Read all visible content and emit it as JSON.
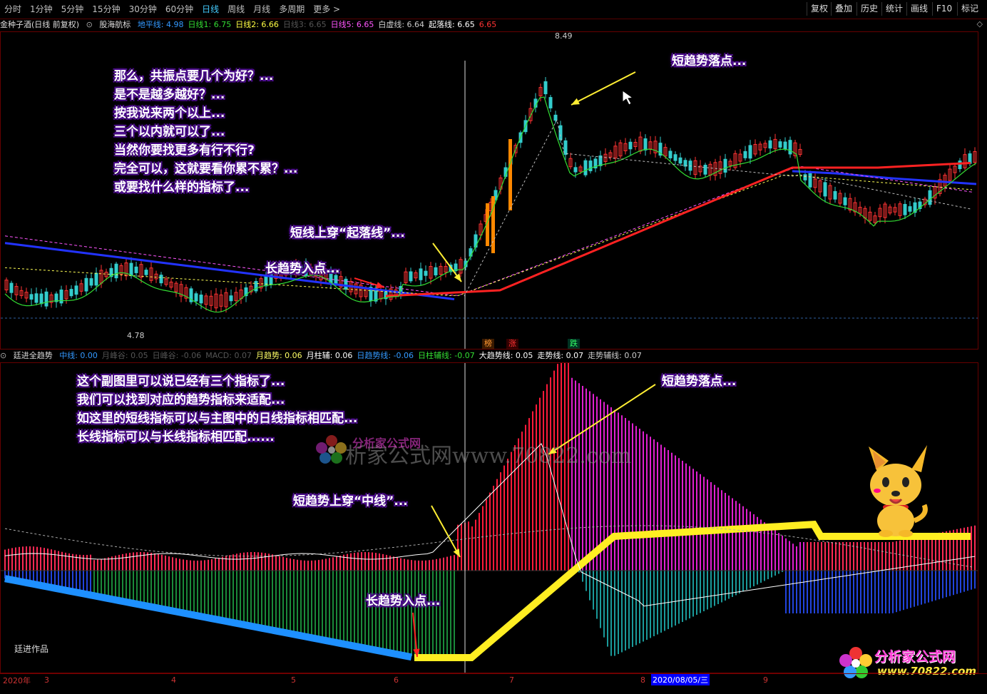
{
  "toolbar": {
    "periods": [
      "分时",
      "1分钟",
      "5分钟",
      "15分钟",
      "30分钟",
      "60分钟",
      "日线",
      "周线",
      "月线",
      "多周期",
      "更多 >"
    ],
    "active_period": "日线",
    "right_buttons": [
      "复权",
      "叠加",
      "历史",
      "统计",
      "画线",
      "F10",
      "标记"
    ]
  },
  "main_legend": {
    "stock": "金种子酒(日线 前复权)",
    "indicator": "股海航标",
    "items": [
      {
        "label": "地平线: 4.98",
        "color": "#3399ff"
      },
      {
        "label": "日线1: 6.75",
        "color": "#33dd33"
      },
      {
        "label": "日线2: 6.66",
        "color": "#ffff44"
      },
      {
        "label": "日线3: 6.65",
        "color": "#555555"
      },
      {
        "label": "日线5: 6.65",
        "color": "#ff55ff"
      },
      {
        "label": "白虚线: 6.64",
        "color": "#cccccc"
      },
      {
        "label": "起落线: 6.65",
        "color": "#ffffff"
      },
      {
        "label": "6.65",
        "color": "#ff3333"
      }
    ]
  },
  "sub_legend": {
    "indicator": "廷进全趋势",
    "items": [
      {
        "label": "中线: 0.00",
        "color": "#3399ff"
      },
      {
        "label": "月峰谷: 0.05",
        "color": "#555555"
      },
      {
        "label": "日峰谷: -0.06",
        "color": "#555555"
      },
      {
        "label": "MACD: 0.07",
        "color": "#555555"
      },
      {
        "label": "月趋势: 0.06",
        "color": "#ffff66"
      },
      {
        "label": "月柱辅: 0.06",
        "color": "#ffffff"
      },
      {
        "label": "日趋势线: -0.06",
        "color": "#3399ff"
      },
      {
        "label": "日柱辅线: -0.07",
        "color": "#33dd33"
      },
      {
        "label": "大趋势线: 0.05",
        "color": "#ffffff"
      },
      {
        "label": "走势线: 0.07",
        "color": "#ffffff"
      },
      {
        "label": "走势辅线: 0.07",
        "color": "#cccccc"
      }
    ]
  },
  "main_notes": {
    "q1": "那么，共振点要几个为好？...",
    "q2": "是不是越多越好？...",
    "q3": "按我说来两个以上...",
    "q4": "三个以内就可以了...",
    "q5": "当然你要找更多有行不行?",
    "q6": "完全可以，这就要看你累不累？...",
    "q7": "或要找什么样的指标了...",
    "short_drop": "短趋势落点...",
    "cross_line": "短线上穿“起落线”...",
    "long_entry": "长趋势入点..."
  },
  "sub_notes": {
    "s1": "这个副图里可以说已经有三个指标了...",
    "s2": "我们可以找到对应的趋势指标来适配...",
    "s3": "如这里的短线指标可以与主图中的日线指标相匹配...",
    "s4": "长线指标可以与长线指标相匹配......",
    "short_drop": "短趋势落点...",
    "cross_mid": "短趋势上穿“中线”...",
    "long_entry": "长趋势入点..."
  },
  "price_labels": {
    "high": "8.49",
    "low": "4.78"
  },
  "signal_tags": {
    "t1": "榜",
    "t2": "涨",
    "t3": "跌"
  },
  "signature": "廷进作品",
  "watermark": {
    "brand": "分析家公式网",
    "url": "www.70822.com",
    "url_display": "析家公式网www.70822.com"
  },
  "axis": {
    "year": "2020年",
    "months": [
      "3",
      "4",
      "5",
      "6",
      "7",
      "8",
      "9"
    ],
    "cursor_date": "2020/08/05/三"
  }
}
